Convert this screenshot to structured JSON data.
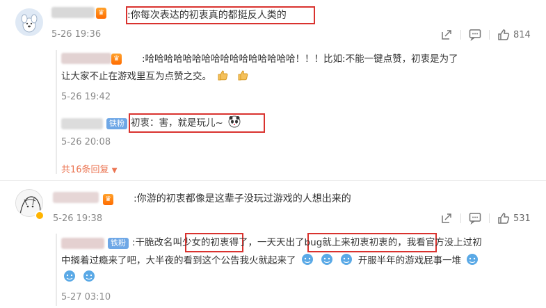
{
  "comments": [
    {
      "text": ":你每次表达的初衷真的都挺反人类的",
      "time": "5-26 19:36",
      "likes": "814",
      "replies": [
        {
          "text_line1": ":哈哈哈哈哈哈哈哈哈哈哈哈哈哈哈哈！！！比如:不能一键点赞，初衷是为了",
          "text_line2": "让大家不止在游戏里互为点赞之交。",
          "time": "5-26 19:42"
        },
        {
          "badge": "铁粉",
          "text": "初衷：害，就是玩儿~",
          "time": "5-26 20:08"
        }
      ],
      "more_label": "共16条回复"
    },
    {
      "text": ":你游的初衷都像是这辈子没玩过游戏的人想出来的",
      "time": "5-26 19:38",
      "likes": "531",
      "replies": [
        {
          "badge": "铁粉",
          "seg1": ":干脆改名叫",
          "seg2": "少女的初衷",
          "seg3": "得了，一天天",
          "seg4": "出了bug就上来初衷初衷的",
          "seg5": "，我看官方没上过初",
          "line2a": "中搁着过瘾来了吧，大半夜的看到这个公告我火就起来了",
          "line2b": "开服半年的游戏屁事一堆",
          "time": "5-27 03:10"
        }
      ]
    }
  ],
  "icons": [
    "share-icon",
    "comment-icon",
    "like-icon",
    "chevron-down-icon"
  ],
  "colors": {
    "highlight_box": "#d9322e",
    "more_link": "#eb7350",
    "fan_badge": "#6ea7e6"
  }
}
